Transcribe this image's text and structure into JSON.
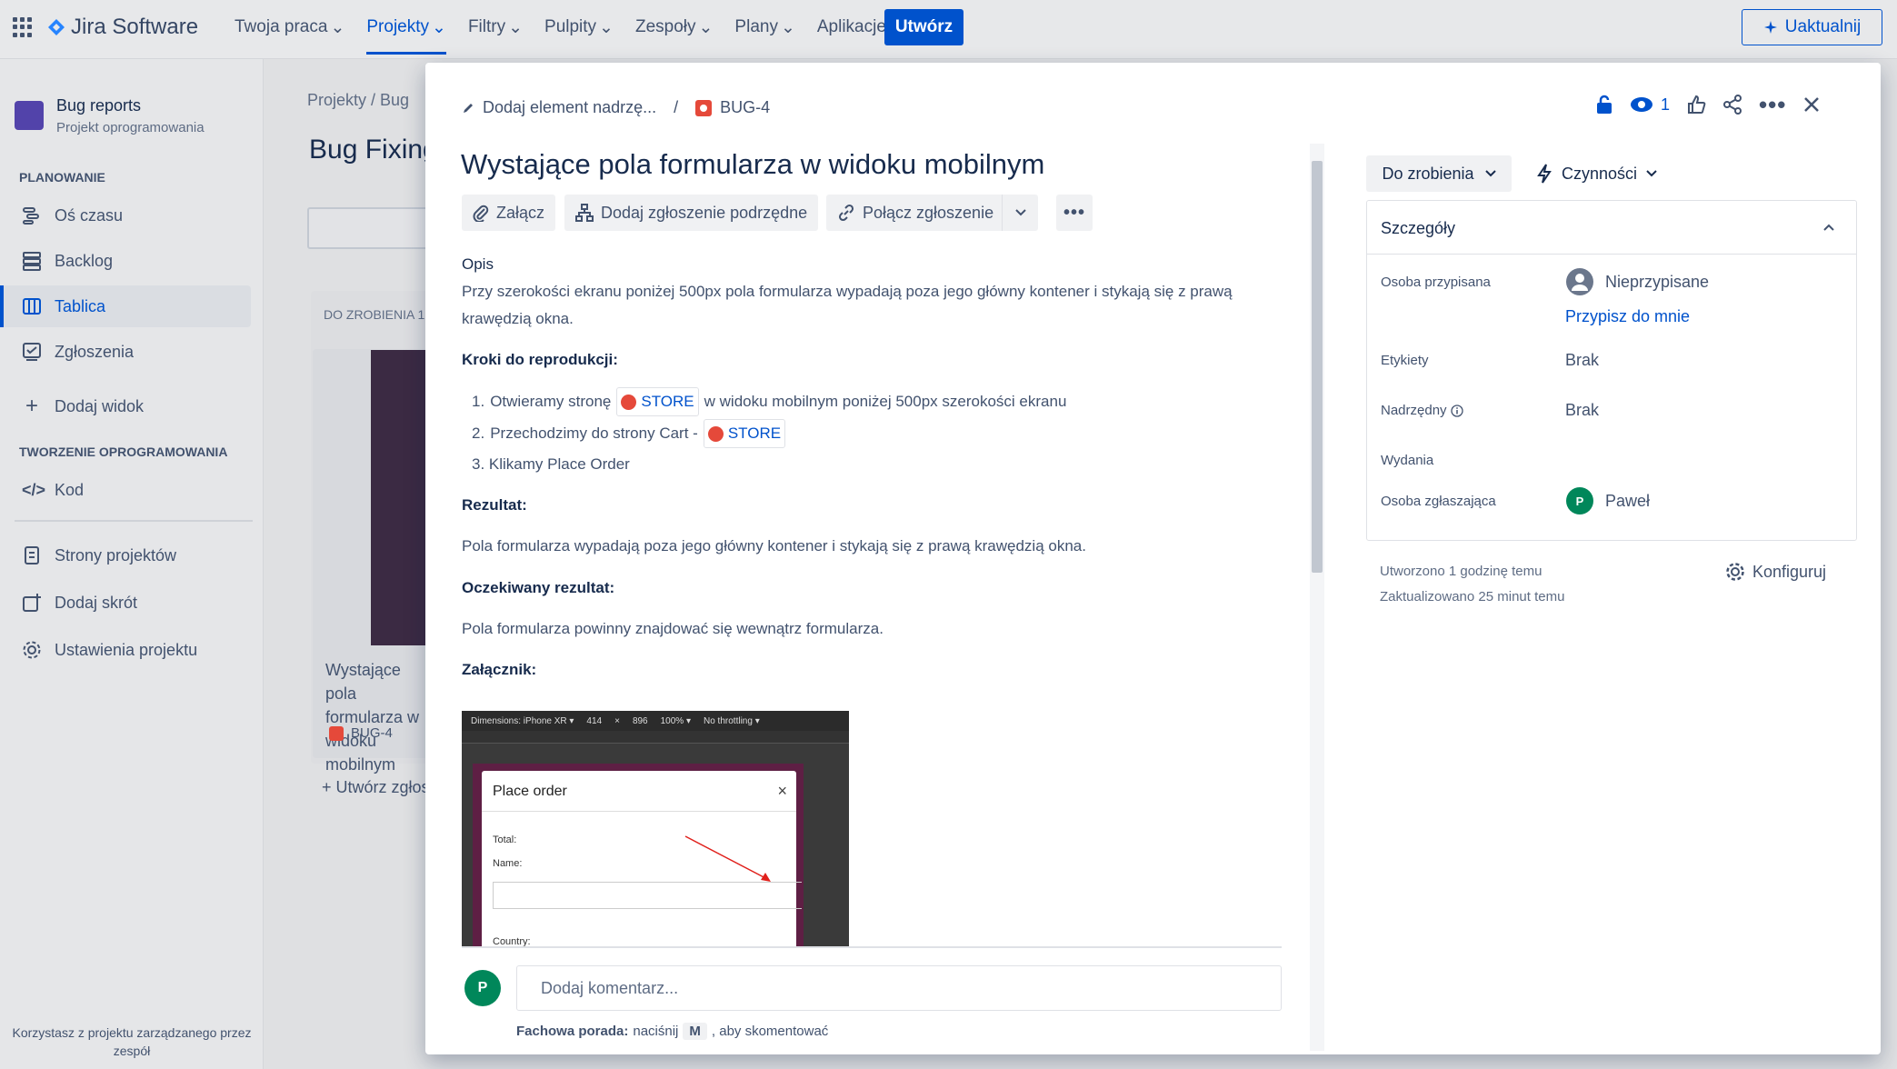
{
  "app": {
    "name": "Jira Software"
  },
  "nav": {
    "items": [
      "Twoja praca",
      "Projekty",
      "Filtry",
      "Pulpity",
      "Zespoły",
      "Plany",
      "Aplikacje"
    ],
    "create": "Utwórz",
    "upgrade": "Uaktualnij"
  },
  "sidebar": {
    "project_name": "Bug reports",
    "project_type": "Projekt oprogramowania",
    "planning_header": "PLANOWANIE",
    "timeline": "Oś czasu",
    "backlog": "Backlog",
    "board": "Tablica",
    "issues": "Zgłoszenia",
    "add_view": "Dodaj widok",
    "dev_header": "TWORZENIE OPROGRAMOWANIA",
    "code": "Kod",
    "project_pages": "Strony projektów",
    "add_shortcut": "Dodaj skrót",
    "project_settings": "Ustawienia projektu",
    "footer": "Korzystasz z projektu zarządzanego przez zespół"
  },
  "board": {
    "crumbs": "Projekty  /  Bug",
    "title": "Bug Fixing",
    "column": "DO ZROBIENIA 1",
    "card_text": "Wystające pola formularza w widoku mobilnym",
    "card_key": "BUG-4",
    "create_issue": "Utwórz zgłoszenie"
  },
  "modal": {
    "add_parent": "Dodaj element nadrzę...",
    "issue_key": "BUG-4",
    "title": "Wystające pola formularza w widoku mobilnym",
    "toolbar": {
      "attach": "Załącz",
      "subtask": "Dodaj zgłoszenie podrzędne",
      "link": "Połącz zgłoszenie"
    },
    "description": {
      "heading": "Opis",
      "intro": "Przy szerokości ekranu poniżej 500px pola formularza wypadają poza jego główny kontener i stykają się z prawą krawędzią okna.",
      "steps_heading": "Kroki do reprodukcji:",
      "step1_num": "1.",
      "step1_a": "Otwieramy stronę",
      "step1_store": "STORE",
      "step1_b": "w widoku mobilnym poniżej 500px szerokości ekranu",
      "step2_num": "2.",
      "step2_a": "Przechodzimy do strony Cart -",
      "step2_store": "STORE",
      "step3": "3. Klikamy Place Order",
      "result_heading": "Rezultat:",
      "result": "Pola formularza wypadają poza jego główny kontener i stykają się z prawą krawędzią okna.",
      "expected_heading": "Oczekiwany rezultat:",
      "expected": "Pola formularza powinny znajdować się wewnątrz formularza.",
      "attachment_heading": "Załącznik:"
    },
    "attachment": {
      "devtools": {
        "dimensions": "Dimensions: iPhone XR ▾",
        "w": "414",
        "x": "×",
        "h": "896",
        "zoom": "100% ▾",
        "throttle": "No throttling ▾"
      },
      "dialog_title": "Place order",
      "close": "×",
      "total": "Total:",
      "name": "Name:",
      "country": "Country:",
      "arrow_color": "#e0201b"
    },
    "comment": {
      "avatar": "P",
      "placeholder": "Dodaj komentarz...",
      "tip_label": "Fachowa porada:",
      "tip_text": "naciśnij",
      "tip_key": "M",
      "tip_after": ", aby skomentować"
    },
    "watchers": "1",
    "status": "Do zrobienia",
    "actions": "Czynności",
    "details": {
      "heading": "Szczegóły",
      "assignee_label": "Osoba przypisana",
      "assignee_value": "Nieprzypisane",
      "assign_me": "Przypisz do mnie",
      "labels_label": "Etykiety",
      "labels_value": "Brak",
      "parent_label": "Nadrzędny",
      "parent_value": "Brak",
      "releases_label": "Wydania",
      "reporter_label": "Osoba zgłaszająca",
      "reporter_avatar": "P",
      "reporter_value": "Paweł"
    },
    "created": "Utworzono 1 godzinę temu",
    "updated": "Zaktualizowano 25 minut temu",
    "configure": "Konfiguruj"
  },
  "colors": {
    "primary": "#0052cc",
    "bug": "#e5493a",
    "avatar": "#00875a"
  }
}
